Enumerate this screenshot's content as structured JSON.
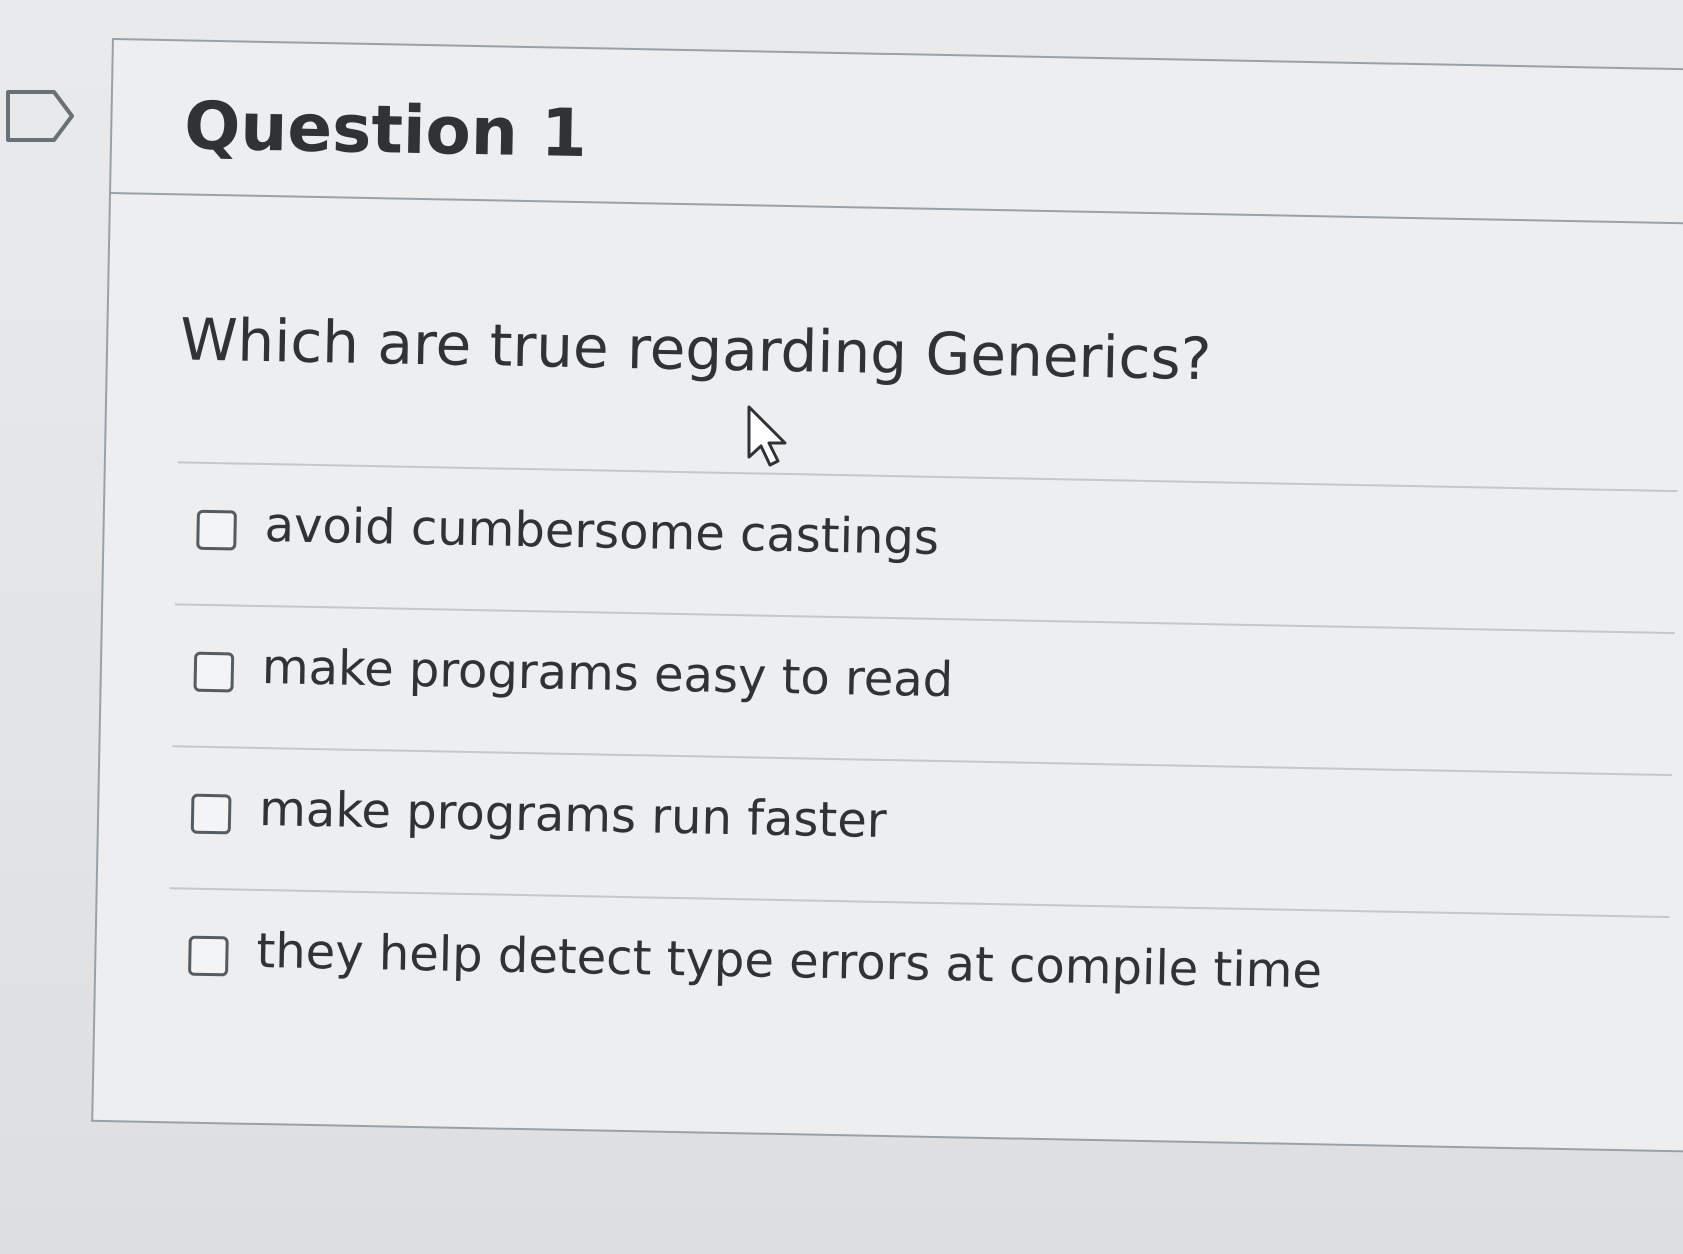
{
  "question": {
    "title": "Question 1",
    "text": "Which are true regarding Generics?",
    "answers": [
      {
        "label": "avoid cumbersome castings",
        "checked": false
      },
      {
        "label": "make programs easy to read",
        "checked": false
      },
      {
        "label": "make programs run faster",
        "checked": false
      },
      {
        "label": "they help detect type errors at compile time",
        "checked": false
      }
    ]
  },
  "icons": {
    "flag": "flag-icon",
    "cursor": "mouse-pointer-icon"
  }
}
